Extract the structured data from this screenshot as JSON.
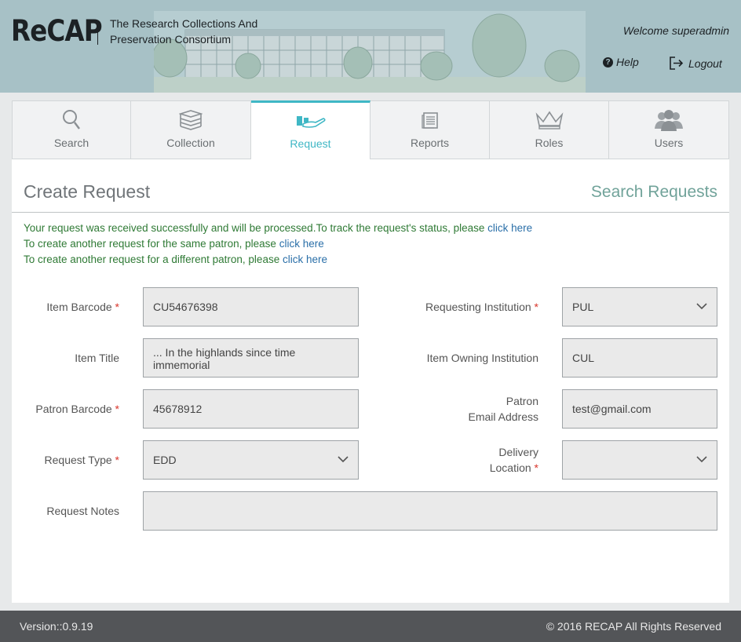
{
  "header": {
    "logo": "ReCAP",
    "consortium_line1": "The Research Collections And",
    "consortium_line2": "Preservation Consortium",
    "welcome": "Welcome superadmin",
    "help": "Help",
    "logout": "Logout"
  },
  "tabs": [
    {
      "label": "Search",
      "icon": "search-icon"
    },
    {
      "label": "Collection",
      "icon": "books-icon"
    },
    {
      "label": "Request",
      "icon": "hand-request-icon",
      "active": true
    },
    {
      "label": "Reports",
      "icon": "document-icon"
    },
    {
      "label": "Roles",
      "icon": "crown-icon"
    },
    {
      "label": "Users",
      "icon": "users-icon"
    }
  ],
  "page": {
    "title": "Create Request",
    "search_requests": "Search Requests"
  },
  "messages": {
    "line1": "Your request was received successfully and will be processed.To track the request's status, please ",
    "line2": "To create another request for the same patron, please ",
    "line3": "To create another request for a different patron, please ",
    "link": "click here"
  },
  "form": {
    "item_barcode_label": "Item Barcode",
    "item_barcode_value": "CU54676398",
    "item_title_label": "Item Title",
    "item_title_value": "... In the highlands since time immemorial",
    "patron_barcode_label": "Patron Barcode",
    "patron_barcode_value": "45678912",
    "request_type_label": "Request Type",
    "request_type_value": "EDD",
    "request_notes_label": "Request Notes",
    "request_notes_value": "",
    "requesting_institution_label": "Requesting Institution",
    "requesting_institution_value": "PUL",
    "item_owning_institution_label": "Item Owning Institution",
    "item_owning_institution_value": "CUL",
    "patron_email_label_line1": "Patron",
    "patron_email_label_line2": "Email Address",
    "patron_email_value": "test@gmail.com",
    "delivery_location_label_line1": "Delivery",
    "delivery_location_label_line2": "Location",
    "delivery_location_value": "",
    "required_mark": "*"
  },
  "footer": {
    "version": "Version::0.9.19",
    "copyright": "© 2016 RECAP All Rights Reserved"
  },
  "colors": {
    "header_bg": "#a7c1c6",
    "accent": "#3fb7c5",
    "success_text": "#2f7a35",
    "link": "#2a6fa8",
    "required": "#d9352b",
    "footer_bg": "#535558"
  }
}
